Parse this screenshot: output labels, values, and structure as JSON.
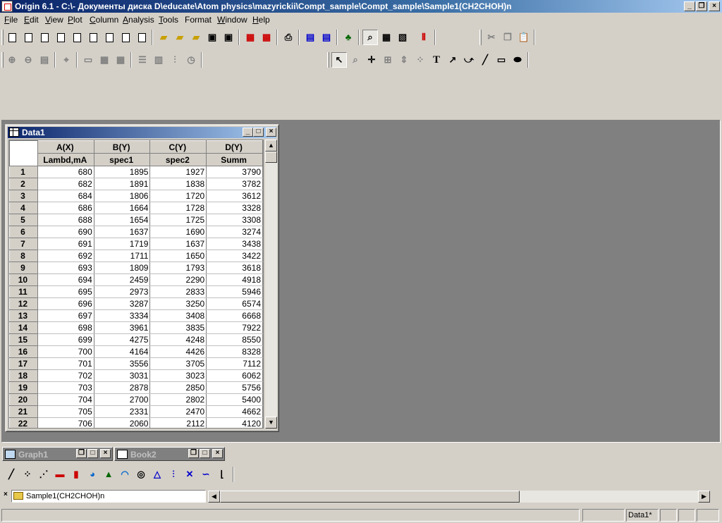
{
  "window": {
    "title": "Origin 6.1 - C:\\- Документы диска D\\educate\\Atom physics\\mazyrickii\\Compt_sample\\Compt_sample\\Sample1(CH2CHOH)n",
    "minimize": "_",
    "restore": "❐",
    "close": "×"
  },
  "menu": [
    {
      "pre": "",
      "key": "F",
      "post": "ile"
    },
    {
      "pre": "",
      "key": "E",
      "post": "dit"
    },
    {
      "pre": "",
      "key": "V",
      "post": "iew"
    },
    {
      "pre": "",
      "key": "P",
      "post": "lot"
    },
    {
      "pre": "",
      "key": "C",
      "post": "olumn"
    },
    {
      "pre": "",
      "key": "A",
      "post": "nalysis"
    },
    {
      "pre": "",
      "key": "T",
      "post": "ools"
    },
    {
      "pre": "",
      "key": "",
      "post": "Format"
    },
    {
      "pre": "",
      "key": "W",
      "post": "indow"
    },
    {
      "pre": "",
      "key": "H",
      "post": "elp"
    }
  ],
  "tools": {
    "text_tool": "T"
  },
  "worksheet": {
    "title": "Data1",
    "columns": [
      {
        "name": "A(X)",
        "label": "Lambd,mA"
      },
      {
        "name": "B(Y)",
        "label": "spec1"
      },
      {
        "name": "C(Y)",
        "label": "spec2"
      },
      {
        "name": "D(Y)",
        "label": "Summ"
      }
    ],
    "rows": [
      [
        "1",
        "680",
        "1895",
        "1927",
        "3790"
      ],
      [
        "2",
        "682",
        "1891",
        "1838",
        "3782"
      ],
      [
        "3",
        "684",
        "1806",
        "1720",
        "3612"
      ],
      [
        "4",
        "686",
        "1664",
        "1728",
        "3328"
      ],
      [
        "5",
        "688",
        "1654",
        "1725",
        "3308"
      ],
      [
        "6",
        "690",
        "1637",
        "1690",
        "3274"
      ],
      [
        "7",
        "691",
        "1719",
        "1637",
        "3438"
      ],
      [
        "8",
        "692",
        "1711",
        "1650",
        "3422"
      ],
      [
        "9",
        "693",
        "1809",
        "1793",
        "3618"
      ],
      [
        "10",
        "694",
        "2459",
        "2290",
        "4918"
      ],
      [
        "11",
        "695",
        "2973",
        "2833",
        "5946"
      ],
      [
        "12",
        "696",
        "3287",
        "3250",
        "6574"
      ],
      [
        "13",
        "697",
        "3334",
        "3408",
        "6668"
      ],
      [
        "14",
        "698",
        "3961",
        "3835",
        "7922"
      ],
      [
        "15",
        "699",
        "4275",
        "4248",
        "8550"
      ],
      [
        "16",
        "700",
        "4164",
        "4426",
        "8328"
      ],
      [
        "17",
        "701",
        "3556",
        "3705",
        "7112"
      ],
      [
        "18",
        "702",
        "3031",
        "3023",
        "6062"
      ],
      [
        "19",
        "703",
        "2878",
        "2850",
        "5756"
      ],
      [
        "20",
        "704",
        "2700",
        "2802",
        "5400"
      ],
      [
        "21",
        "705",
        "2331",
        "2470",
        "4662"
      ],
      [
        "22",
        "706",
        "2060",
        "2112",
        "4120"
      ]
    ]
  },
  "minimized_windows": [
    {
      "title": "Graph1"
    },
    {
      "title": "Book2"
    }
  ],
  "project": {
    "folder": "Sample1(CH2CHOH)n"
  },
  "status": {
    "active_window": "Data1*"
  }
}
